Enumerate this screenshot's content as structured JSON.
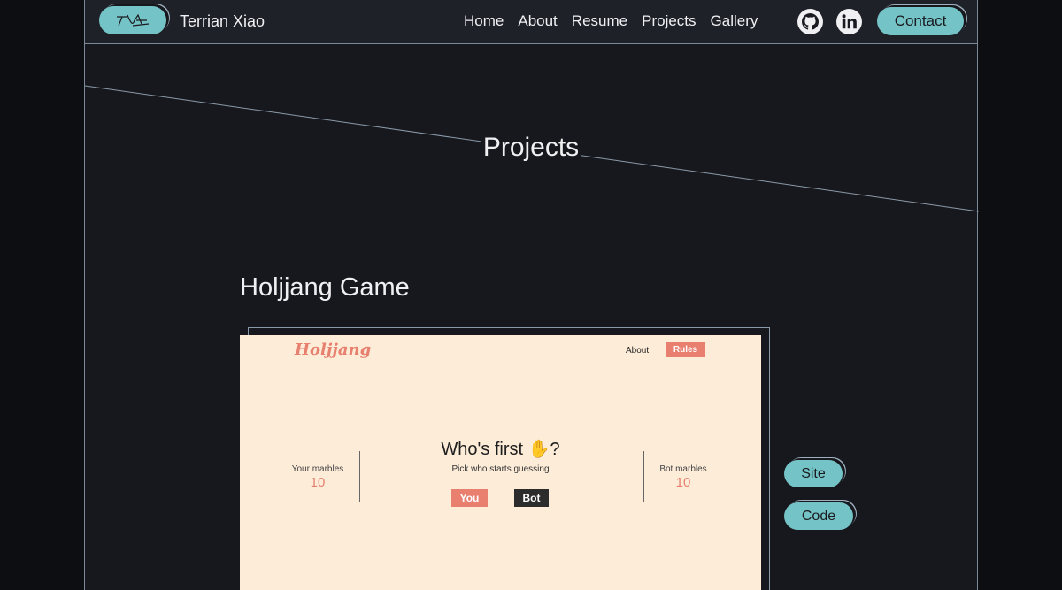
{
  "navbar": {
    "brand": "Terrian Xiao",
    "links": [
      "Home",
      "About",
      "Resume",
      "Projects",
      "Gallery"
    ],
    "github_icon": "github-icon",
    "linkedin_icon": "linkedin-icon",
    "contact_label": "Contact"
  },
  "page": {
    "title": "Projects"
  },
  "project": {
    "title": "Holjjang Game",
    "site_label": "Site",
    "code_label": "Code",
    "preview": {
      "logo": "Holjjang",
      "about": "About",
      "rules": "Rules",
      "heading": "Who's first ✋?",
      "subheading": "Pick who starts guessing",
      "you_label": "Your marbles",
      "you_value": "10",
      "bot_label": "Bot marbles",
      "bot_value": "10",
      "btn_you": "You",
      "btn_bot": "Bot"
    }
  },
  "colors": {
    "accent": "#74c3c6",
    "background": "#17181d",
    "preview_bg": "#fdecd8",
    "preview_accent": "#e97f6e"
  }
}
